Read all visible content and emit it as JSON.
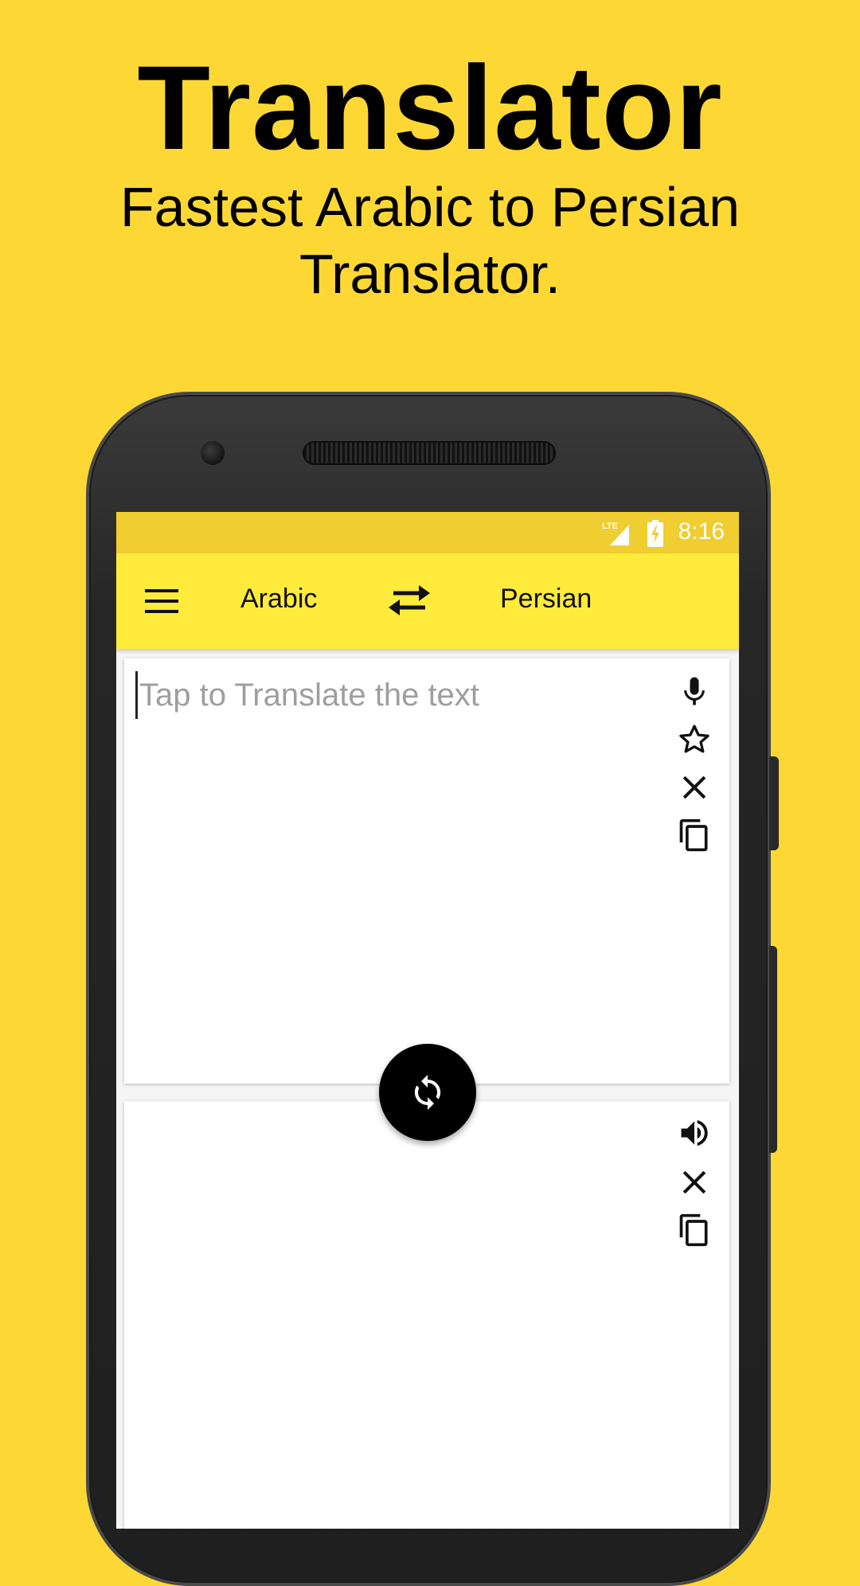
{
  "promo": {
    "title": "Translator",
    "subtitle": "Fastest Arabic to Persian Translator."
  },
  "status_bar": {
    "network": "LTE",
    "time": "8:16"
  },
  "toolbar": {
    "source_language": "Arabic",
    "target_language": "Persian"
  },
  "input": {
    "placeholder": "Tap to Translate the text",
    "value": ""
  },
  "icons": {
    "menu": "menu-icon",
    "swap": "swap-languages-icon",
    "mic": "microphone-icon",
    "favorite": "star-icon",
    "clear": "close-icon",
    "copy": "copy-icon",
    "speak": "speaker-icon",
    "translate": "refresh-icon"
  },
  "colors": {
    "background": "#FDD835",
    "toolbar": "#FFEB3B",
    "status_bar": "#F0CD30",
    "fab": "#000000"
  }
}
